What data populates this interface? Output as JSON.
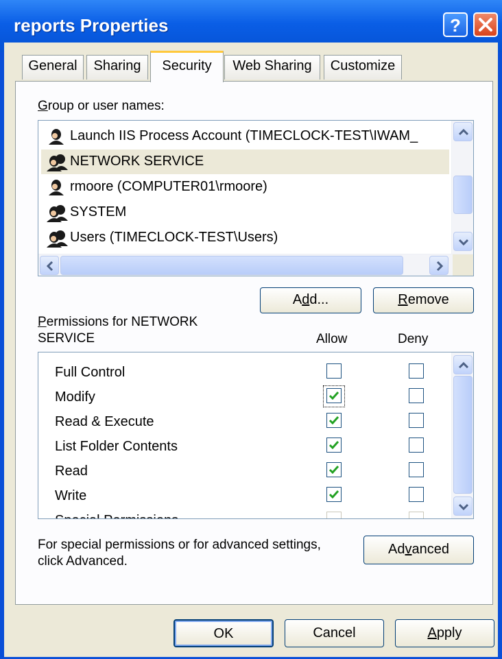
{
  "window": {
    "title": "reports Properties"
  },
  "titlebar": {
    "help_icon": "help-icon",
    "close_icon": "close-icon"
  },
  "tabs": [
    {
      "label": "General",
      "active": false
    },
    {
      "label": "Sharing",
      "active": false
    },
    {
      "label": "Security",
      "active": true
    },
    {
      "label": "Web Sharing",
      "active": false
    },
    {
      "label": "Customize",
      "active": false
    }
  ],
  "security": {
    "group_label_accel": "G",
    "group_label_rest": "roup or user names:",
    "users": [
      {
        "name": "Launch IIS Process Account (TIMECLOCK-TEST\\IWAM_",
        "icon": "user-icon",
        "selected": false
      },
      {
        "name": "NETWORK SERVICE",
        "icon": "group-icon",
        "selected": true
      },
      {
        "name": "rmoore (COMPUTER01\\rmoore)",
        "icon": "user-icon",
        "selected": false
      },
      {
        "name": "SYSTEM",
        "icon": "group-icon",
        "selected": false
      },
      {
        "name": "Users (TIMECLOCK-TEST\\Users)",
        "icon": "group-icon",
        "selected": false
      }
    ],
    "add_pre": "A",
    "add_accel": "d",
    "add_post": "d...",
    "remove_accel": "R",
    "remove_rest": "emove",
    "permissions_label_accel": "P",
    "permissions_label_line1_rest": "ermissions for NETWORK",
    "permissions_label_line2": "SERVICE",
    "allow_header": "Allow",
    "deny_header": "Deny",
    "permissions": [
      {
        "name": "Full Control",
        "allow": false,
        "deny": false
      },
      {
        "name": "Modify",
        "allow": true,
        "deny": false
      },
      {
        "name": "Read & Execute",
        "allow": true,
        "deny": false
      },
      {
        "name": "List Folder Contents",
        "allow": true,
        "deny": false
      },
      {
        "name": "Read",
        "allow": true,
        "deny": false
      },
      {
        "name": "Write",
        "allow": true,
        "deny": false
      },
      {
        "name": "Special Permissions",
        "allow": false,
        "deny": false
      }
    ],
    "advanced_text_line1": "For special permissions or for advanced settings,",
    "advanced_text_line2": "click Advanced.",
    "advanced_pre": "Ad",
    "advanced_accel": "v",
    "advanced_post": "anced"
  },
  "footer": {
    "ok_label": "OK",
    "cancel_label": "Cancel",
    "apply_accel": "A",
    "apply_rest": "pply"
  },
  "colors": {
    "titlebar": "#0a5ee6",
    "face": "#ece9d8",
    "check": "#21a121"
  }
}
